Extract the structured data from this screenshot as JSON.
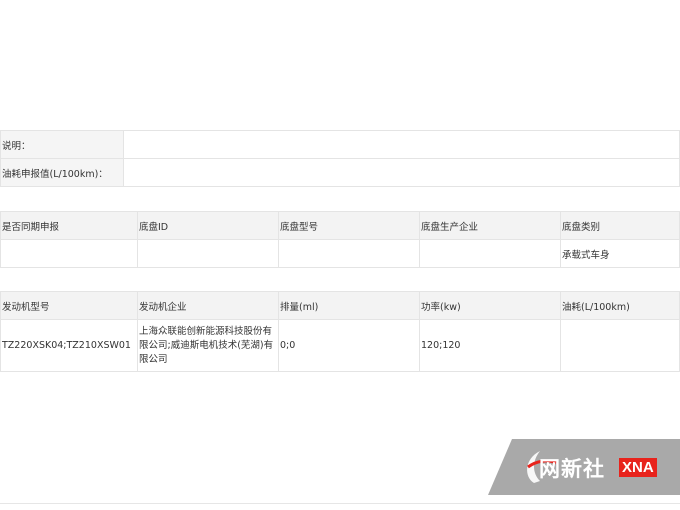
{
  "info": {
    "note_label": "说明：",
    "note_value": "",
    "fuel_label": "油耗申报值(L/100km)：",
    "fuel_value": ""
  },
  "chassis": {
    "headers": [
      "是否同期申报",
      "底盘ID",
      "底盘型号",
      "底盘生产企业",
      "底盘类别"
    ],
    "row": [
      "",
      "",
      "",
      "",
      "承载式车身"
    ]
  },
  "engine": {
    "headers": [
      "发动机型号",
      "发动机企业",
      "排量(ml)",
      "功率(kw)",
      "油耗(L/100km)"
    ],
    "row": [
      "TZ220XSK04;TZ210XSW01",
      "上海众联能创新能源科技股份有限公司;威迪斯电机技术(芜湖)有限公司",
      "0;0",
      "120;120",
      ""
    ]
  },
  "watermark": {
    "name_cn": "网新社",
    "name_en": "XNA",
    "accent_color": "#e8231c",
    "icon": "xna-swoosh-logo"
  }
}
